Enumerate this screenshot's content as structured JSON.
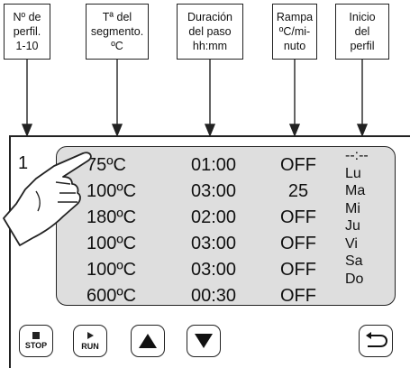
{
  "header_boxes": [
    {
      "label": "Nº de\nperfil.\n1-10"
    },
    {
      "label": "Tª del\nsegmento.\nºC"
    },
    {
      "label": "Duración\ndel paso\nhh:mm"
    },
    {
      "label": "Rampa\nºC/mi-\nnuto"
    },
    {
      "label": "Inicio\ndel\nperfil"
    }
  ],
  "profile_number": "1",
  "rows": [
    {
      "temp": "75ºC",
      "duration": "01:00",
      "ramp": "OFF"
    },
    {
      "temp": "100ºC",
      "duration": "03:00",
      "ramp": "25"
    },
    {
      "temp": "180ºC",
      "duration": "02:00",
      "ramp": "OFF"
    },
    {
      "temp": "100ºC",
      "duration": "03:00",
      "ramp": "OFF"
    },
    {
      "temp": "100ºC",
      "duration": "03:00",
      "ramp": "OFF"
    },
    {
      "temp": "600ºC",
      "duration": "00:30",
      "ramp": "OFF"
    }
  ],
  "start_time": "--:--",
  "days": [
    "Lu",
    "Ma",
    "Mi",
    "Ju",
    "Vi",
    "Sa",
    "Do"
  ],
  "buttons": {
    "stop_label": "STOP",
    "run_label": "RUN"
  },
  "icons": {
    "stop": "stop-square-icon",
    "run": "play-triangle-icon",
    "up": "up-triangle-icon",
    "down": "down-triangle-icon",
    "back": "return-arrow-icon",
    "hand": "pointing-hand-icon"
  },
  "colors": {
    "panel_bg": "#dedede",
    "line": "#222222"
  }
}
